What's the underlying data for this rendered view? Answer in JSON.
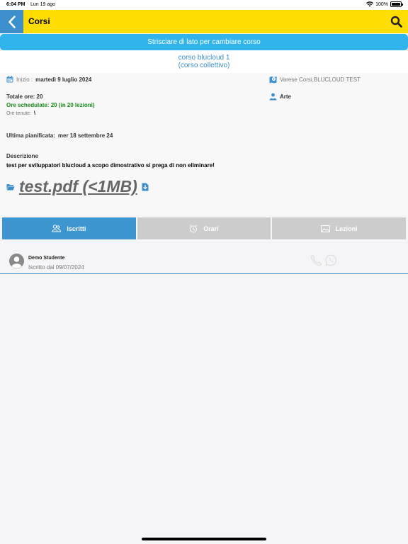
{
  "status_bar": {
    "time": "6:04 PM",
    "date": "Lun 19 ago",
    "battery": "100%"
  },
  "nav": {
    "title": "Corsi",
    "back_icon": "chevron-left-icon",
    "search_icon": "search-icon"
  },
  "banner": {
    "text": "Strisciare di lato per cambiare corso"
  },
  "course": {
    "name": "corso blucloud 1",
    "type": "(corso collettivo)",
    "start_label": "Inizio :",
    "start_date": "martedì 9 luglio 2024",
    "location": "Varese Corsi,BLUCLOUD TEST",
    "total_hours": "Totale ore: 20",
    "scheduled_hours": "Ore schedulate: 20 (in 20 lezioni)",
    "held_label": "Ore tenute:",
    "held_value": "\\",
    "subject": "Arte",
    "last_planned_label": "Ultima pianificata:",
    "last_planned_value": "mer 18 settembre 24",
    "description_label": "Descrizione",
    "description_text": "test per sviluppatori blucloud a scopo dimostrativo si prega di non eliminare!",
    "file_label": "test.pdf (<1MB) "
  },
  "tabs": [
    {
      "label": "Iscritti",
      "icon": "users-icon",
      "active": true
    },
    {
      "label": "Orari",
      "icon": "alarm-clock-icon",
      "active": false
    },
    {
      "label": "Lezioni",
      "icon": "image-icon",
      "active": false
    }
  ],
  "students": [
    {
      "name": "Demo Studente",
      "enrolled": "Iscritto dal 09/07/2024"
    }
  ],
  "colors": {
    "nav_yellow": "#ffdd00",
    "accent_blue": "#3b8fcc",
    "banner_blue": "#31b4ec",
    "green": "#158a15"
  }
}
